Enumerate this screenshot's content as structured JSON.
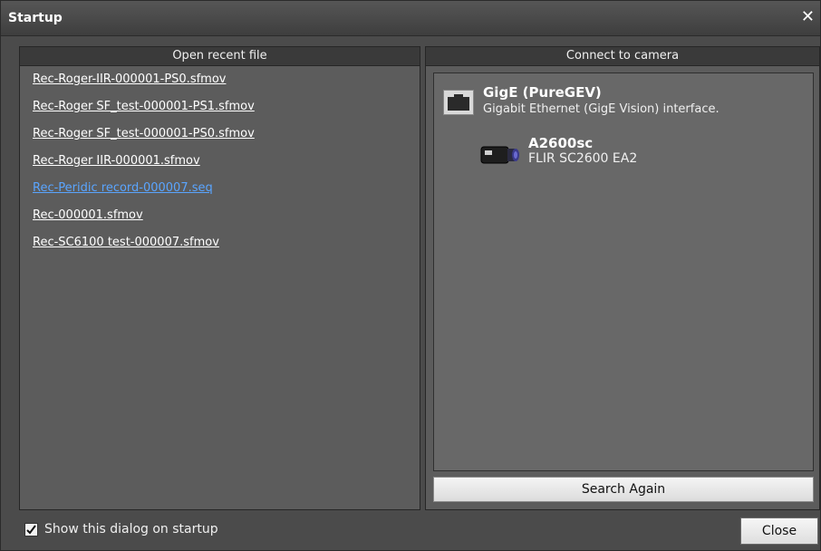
{
  "window": {
    "title": "Startup",
    "close_glyph": "✕"
  },
  "recent": {
    "header": "Open recent file",
    "files": [
      "Rec-Roger-IIR-000001-PS0.sfmov",
      "Rec-Roger SF_test-000001-PS1.sfmov",
      "Rec-Roger SF_test-000001-PS0.sfmov",
      "Rec-Roger IIR-000001.sfmov",
      "Rec-Peridic record-000007.seq",
      "Rec-000001.sfmov",
      "Rec-SC6100 test-000007.sfmov"
    ],
    "hovered_index": 4,
    "hover_color": "#5aa5ff"
  },
  "camera": {
    "header": "Connect to camera",
    "interface": {
      "name": "GigE (PureGEV)",
      "description": "Gigabit Ethernet (GigE Vision) interface.",
      "icon": "ethernet-port-icon"
    },
    "device": {
      "name": "A2600sc",
      "model": "FLIR SC2600 EA2",
      "icon": "camera-icon"
    },
    "search_button": "Search Again"
  },
  "footer": {
    "show_on_startup_label": "Show this dialog on startup",
    "show_on_startup_checked": true,
    "close_button": "Close"
  }
}
